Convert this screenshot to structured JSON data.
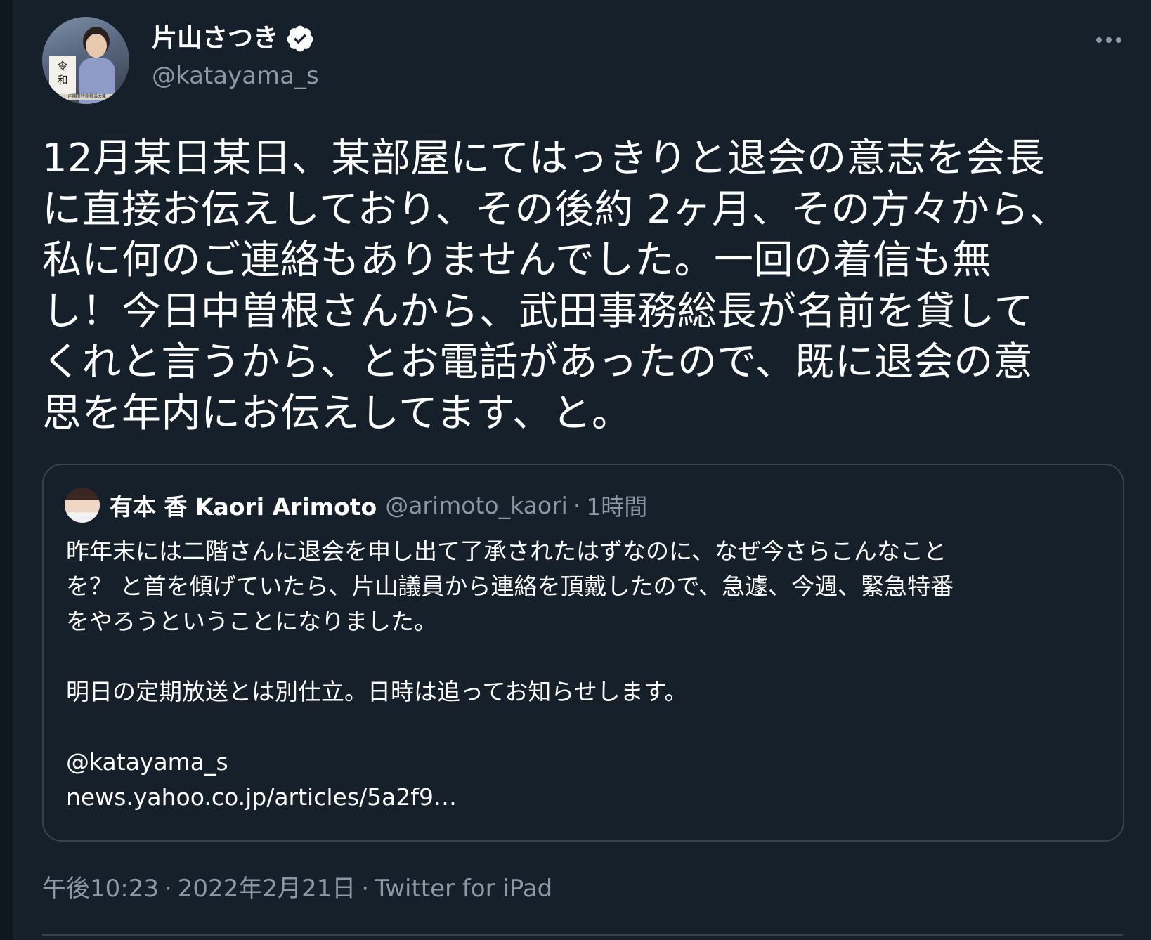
{
  "author": {
    "display_name": "片山さつき",
    "handle": "@katayama_s",
    "verified_icon": "verified-badge-icon",
    "avatar_sign_text": "令\n和",
    "avatar_caption": "内閣府特命担当大臣"
  },
  "tweet": {
    "text": "12月某日某日、某部屋にてはっきりと退会の意志を会長\nに直接お伝えしており、その後約 2ヶ月、その方々から、\n私に何のご連絡もありませんでした。一回の着信も無\nし！今日中曽根さんから、武田事務総長が名前を貸して\nくれと言うから、とお電話があったので、既に退会の意\n思を年内にお伝えしてます、と。"
  },
  "quote": {
    "name": "有本 香 Kaori Arimoto",
    "handle": "@arimoto_kaori",
    "separator": "·",
    "time": "1時間",
    "body": "昨年末には二階さんに退会を申し出て了承されたはずなのに、なぜ今さらこんなこと\nを？ と首を傾げていたら、片山議員から連絡を頂戴したので、急遽、今週、緊急特番\nをやろうということになりました。\n\n明日の定期放送とは別仕立。日時は追ってお知らせします。\n\n@katayama_s\nnews.yahoo.co.jp/articles/5a2f9…"
  },
  "meta": {
    "time": "午後10:23",
    "separator": "·",
    "date": "2022年2月21日",
    "source": "Twitter for iPad"
  },
  "icons": {
    "more": "more-options-icon"
  },
  "colors": {
    "background": "#15202b",
    "text": "#ffffff",
    "secondary_text": "#8b98a5",
    "border": "#38444d"
  }
}
